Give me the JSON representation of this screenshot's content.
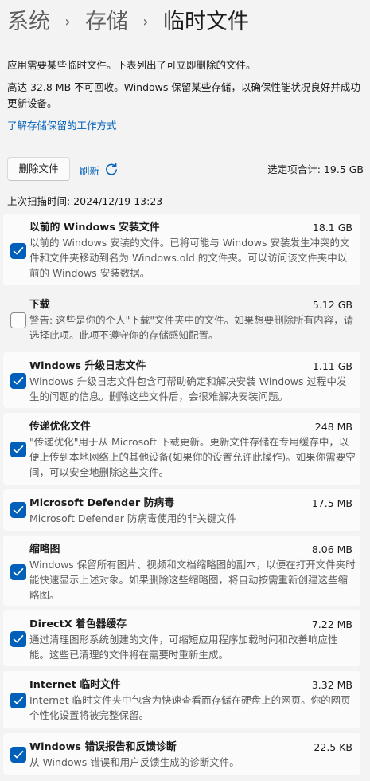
{
  "breadcrumb": {
    "items": [
      "系统",
      "存储",
      "临时文件"
    ]
  },
  "intro": {
    "line1": "应用需要某些临时文件。下表列出了可立即删除的文件。",
    "line2": "高达 32.8 MB 不可回收。Windows 保留某些存储，以确保性能状况良好并成功更新设备。",
    "link": "了解存储保留的工作方式"
  },
  "toolbar": {
    "delete_label": "删除文件",
    "refresh_label": "刷新",
    "total_label": "选定项合计: 19.5 GB",
    "last_scan": "上次扫描时间: 2024/12/19 13:23"
  },
  "items": [
    {
      "title": "以前的 Windows 安装文件",
      "size": "18.1 GB",
      "checked": true,
      "desc": "以前的 Windows 安装的文件。已将可能与 Windows 安装发生冲突的文件和文件夹移动到名为 Windows.old 的文件夹。可以访问该文件夹中以前的 Windows 安装数据。"
    },
    {
      "title": "下载",
      "size": "5.12 GB",
      "checked": false,
      "desc": "警告: 这些是你的个人\"下载\"文件夹中的文件。如果想要删除所有内容，请选择此项。此项不遵守你的存储感知配置。"
    },
    {
      "title": "Windows 升级日志文件",
      "size": "1.11 GB",
      "checked": true,
      "desc": "Windows 升级日志文件包含可帮助确定和解决安装 Windows 过程中发生的问题的信息。删除这些文件后，会很难解决安装问题。"
    },
    {
      "title": "传递优化文件",
      "size": "248 MB",
      "checked": true,
      "desc": "\"传递优化\"用于从 Microsoft 下载更新。更新文件存储在专用缓存中，以便上传到本地网络上的其他设备(如果你的设置允许此操作)。如果你需要空间，可以安全地删除这些文件。"
    },
    {
      "title": "Microsoft Defender 防病毒",
      "size": "17.5 MB",
      "checked": true,
      "desc": "Microsoft Defender 防病毒使用的非关键文件"
    },
    {
      "title": "缩略图",
      "size": "8.06 MB",
      "checked": true,
      "desc": "Windows 保留所有图片、视频和文档缩略图的副本，以便在打开文件夹时能快速显示上述对象。如果删除这些缩略图，将自动按需重新创建这些缩略图。"
    },
    {
      "title": "DirectX 着色器缓存",
      "size": "7.22 MB",
      "checked": true,
      "desc": "通过清理图形系统创建的文件，可缩短应用程序加载时间和改善响应性能。这些已清理的文件将在需要时重新生成。"
    },
    {
      "title": "Internet 临时文件",
      "size": "3.32 MB",
      "checked": true,
      "desc": "Internet 临时文件夹中包含为快速查看而存储在硬盘上的网页。你的网页个性化设置将被完整保留。"
    },
    {
      "title": "Windows 错误报告和反馈诊断",
      "size": "22.5 KB",
      "checked": true,
      "desc": "从 Windows 错误和用户反馈生成的诊断文件。"
    }
  ]
}
